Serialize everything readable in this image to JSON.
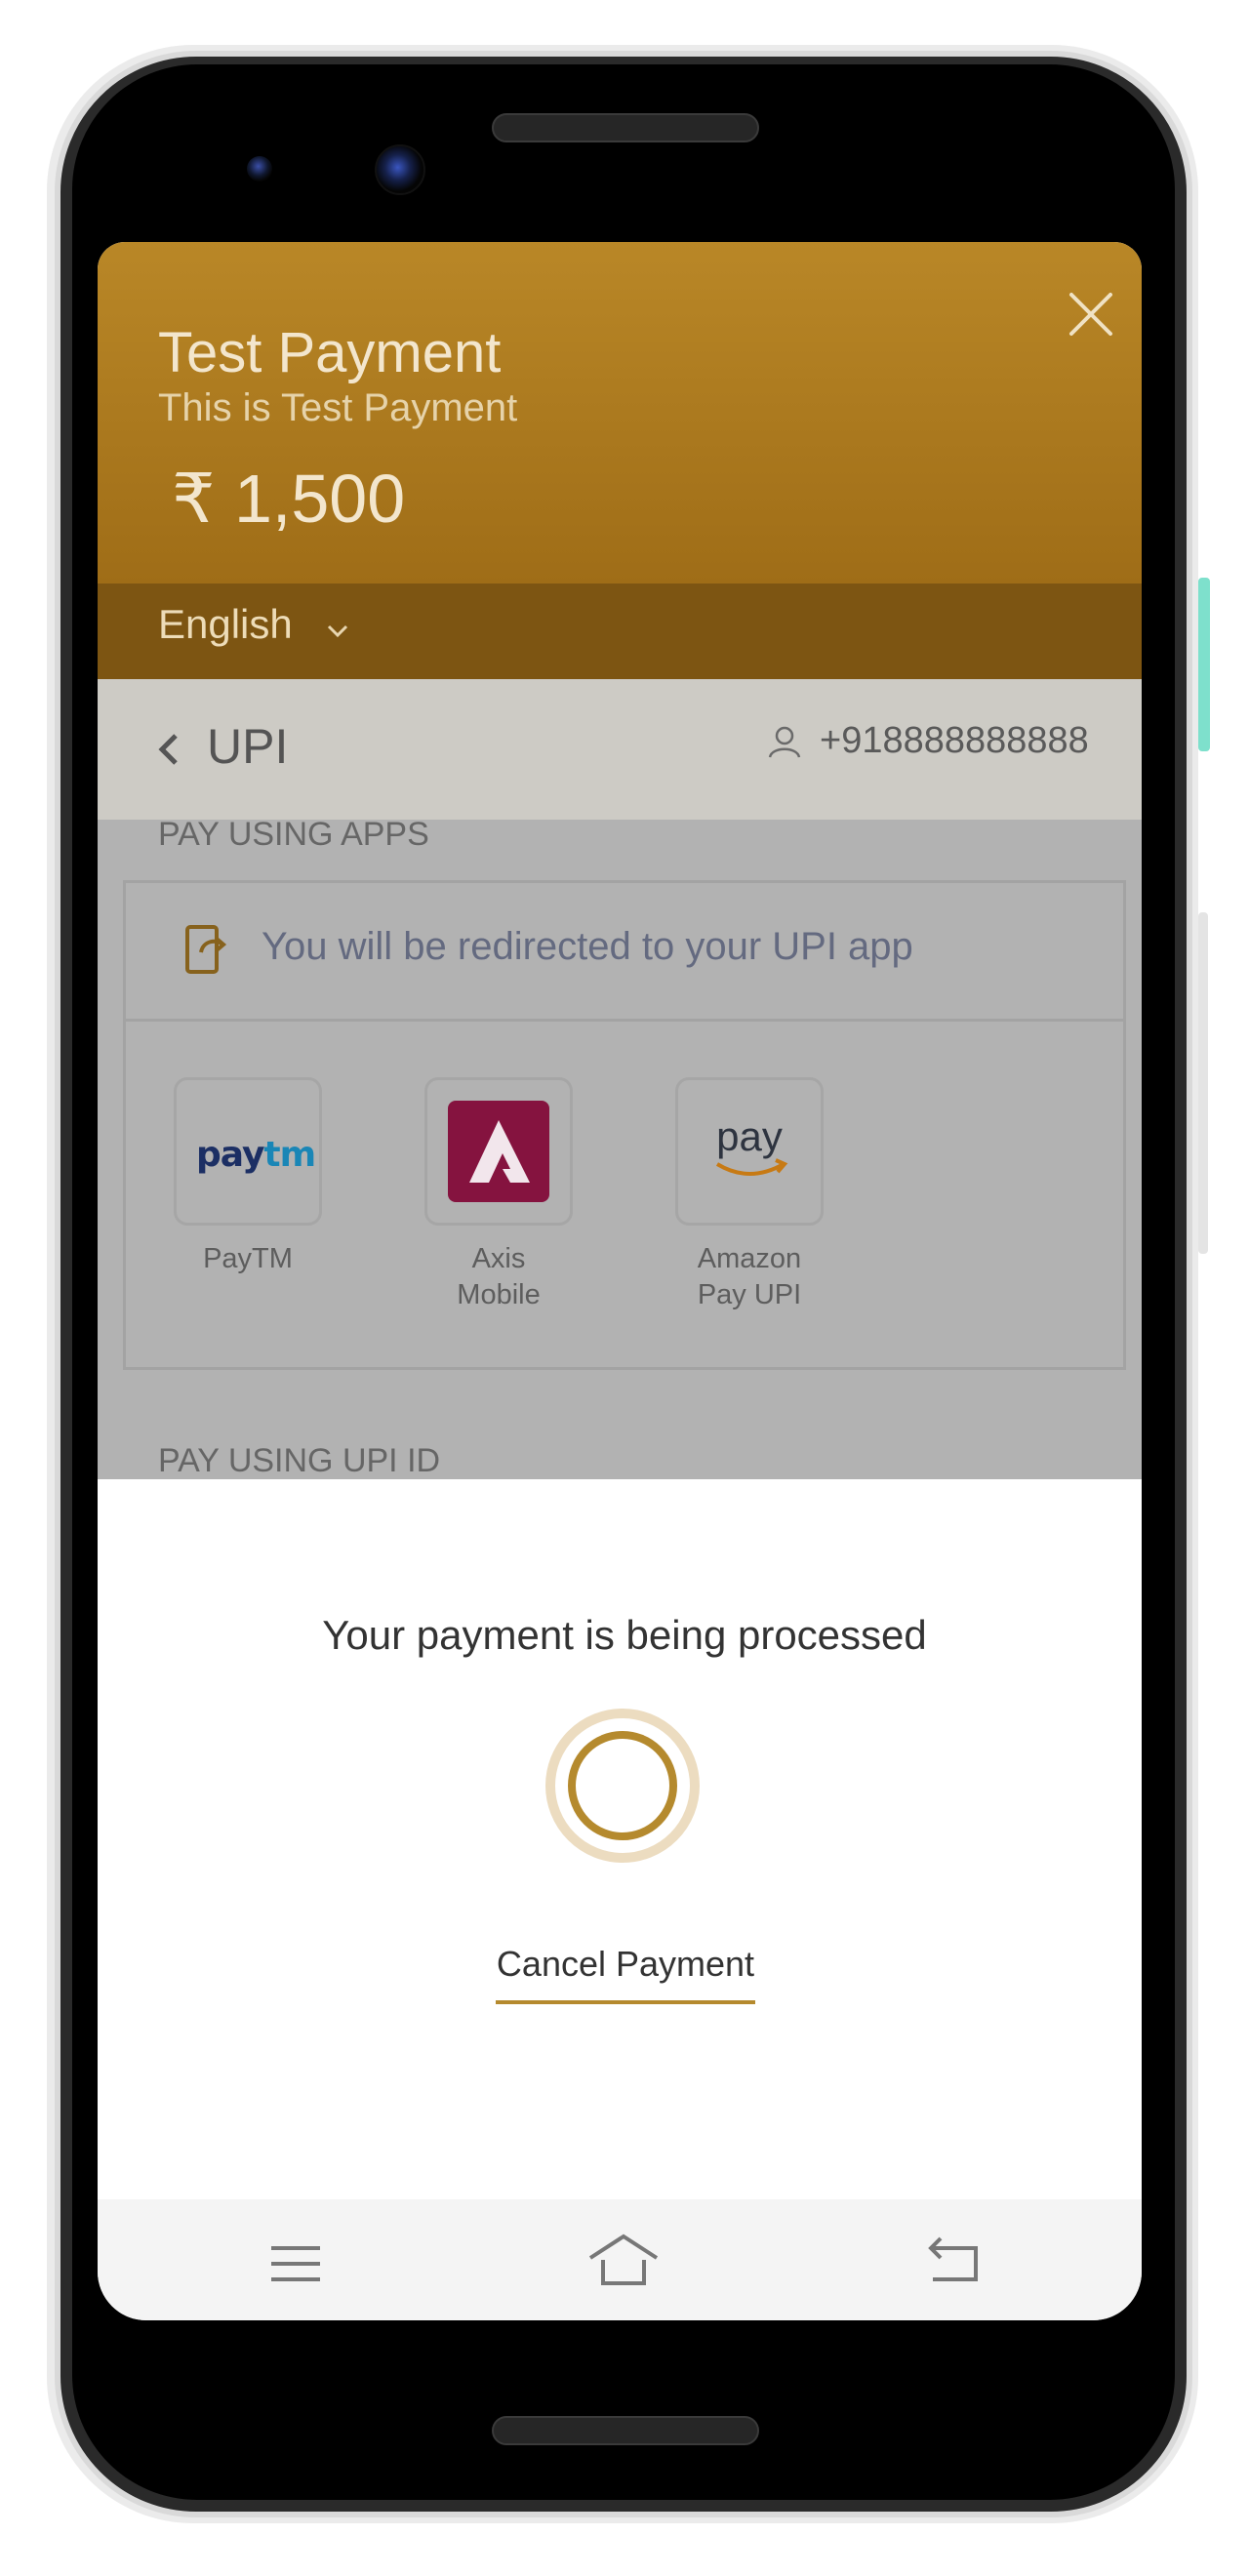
{
  "header": {
    "title": "Test Payment",
    "subtitle": "This is Test Payment",
    "amount": "₹ 1,500",
    "language": "English",
    "close_icon": "close-icon",
    "accent_color": "#b0802a"
  },
  "upi_bar": {
    "title": "UPI",
    "phone_number": "+918888888888",
    "back_icon": "chevron-left-icon",
    "user_icon": "user-icon"
  },
  "apps_section": {
    "heading": "PAY USING APPS",
    "redirect_text": "You will be redirected to your UPI app",
    "apps": [
      {
        "name_line1": "PayTM",
        "name_line2": "",
        "logo_text_a": "pay",
        "logo_text_b": "tm",
        "icon": "paytm-logo"
      },
      {
        "name_line1": "Axis",
        "name_line2": "Mobile",
        "icon": "axis-logo"
      },
      {
        "name_line1": "Amazon",
        "name_line2": "Pay UPI",
        "logo_text": "pay",
        "icon": "amazon-pay-logo"
      }
    ]
  },
  "upi_id_section": {
    "heading": "PAY USING UPI ID"
  },
  "processing": {
    "message": "Your payment is being processed",
    "cancel_label": "Cancel Payment",
    "spinner_color": "#b58a2e"
  },
  "nav": {
    "menu_icon": "menu-icon",
    "home_icon": "home-icon",
    "back_icon": "back-icon"
  }
}
